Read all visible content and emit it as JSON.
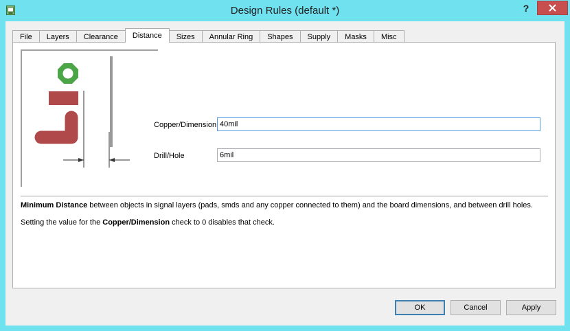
{
  "window": {
    "title": "Design Rules (default *)",
    "help_label": "?",
    "close_label": "✕"
  },
  "tabs": [
    {
      "label": "File"
    },
    {
      "label": "Layers"
    },
    {
      "label": "Clearance"
    },
    {
      "label": "Distance",
      "active": true
    },
    {
      "label": "Sizes"
    },
    {
      "label": "Annular Ring"
    },
    {
      "label": "Shapes"
    },
    {
      "label": "Supply"
    },
    {
      "label": "Masks"
    },
    {
      "label": "Misc"
    }
  ],
  "fields": {
    "copper_label": "Copper/Dimension",
    "copper_value": "40mil",
    "drill_label": "Drill/Hole",
    "drill_value": "6mil"
  },
  "description": {
    "line1_bold": "Minimum Distance",
    "line1_rest": " between objects in signal layers (pads, smds and any copper connected to them) and the board dimensions, and between drill holes.",
    "line2_pre": "Setting the value for the ",
    "line2_bold": "Copper/Dimension",
    "line2_post": " check to 0 disables that check."
  },
  "buttons": {
    "ok": "OK",
    "cancel": "Cancel",
    "apply": "Apply"
  },
  "colors": {
    "pad": "#4ca648",
    "copper": "#b04a4a",
    "dimension": "#9a9a9a",
    "window_frame": "#6ee0ee",
    "close_button": "#c7504f"
  }
}
